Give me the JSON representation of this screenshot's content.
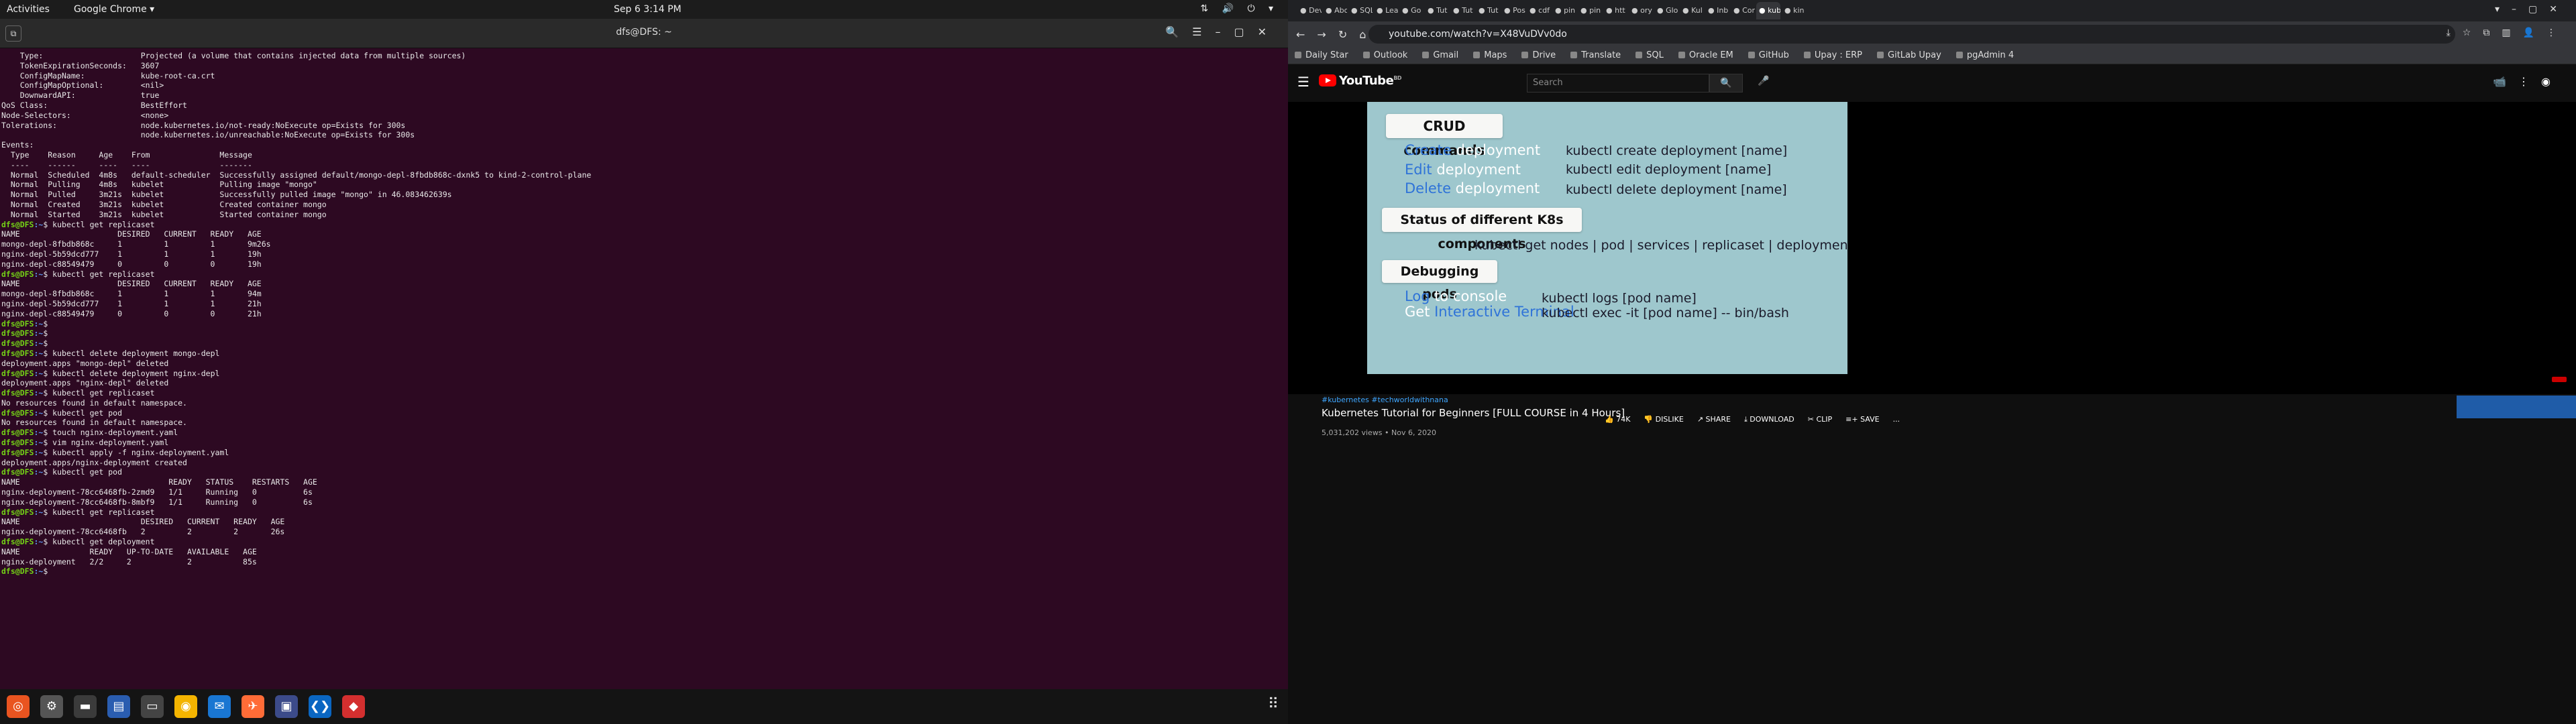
{
  "topbar": {
    "activities": "Activities",
    "app": "Google Chrome ▾",
    "clock": "Sep 6  3:14 PM",
    "tray": "⇅ 🔊 ⏻ ▾"
  },
  "terminal": {
    "title": "dfs@DFS: ~",
    "lines": [
      {
        "t": "    Type:                     Projected (a volume that contains injected data from multiple sources)"
      },
      {
        "t": "    TokenExpirationSeconds:   3607"
      },
      {
        "t": "    ConfigMapName:            kube-root-ca.crt"
      },
      {
        "t": "    ConfigMapOptional:        <nil>"
      },
      {
        "t": "    DownwardAPI:              true"
      },
      {
        "t": "QoS Class:                    BestEffort"
      },
      {
        "t": "Node-Selectors:               <none>"
      },
      {
        "t": "Tolerations:                  node.kubernetes.io/not-ready:NoExecute op=Exists for 300s"
      },
      {
        "t": "                              node.kubernetes.io/unreachable:NoExecute op=Exists for 300s"
      },
      {
        "t": "Events:"
      },
      {
        "t": "  Type    Reason     Age    From               Message"
      },
      {
        "t": "  ----    ------     ----   ----               -------"
      },
      {
        "t": "  Normal  Scheduled  4m8s   default-scheduler  Successfully assigned default/mongo-depl-8fbdb868c-dxnk5 to kind-2-control-plane"
      },
      {
        "t": "  Normal  Pulling    4m8s   kubelet            Pulling image \"mongo\""
      },
      {
        "t": "  Normal  Pulled     3m21s  kubelet            Successfully pulled image \"mongo\" in 46.083462639s"
      },
      {
        "t": "  Normal  Created    3m21s  kubelet            Created container mongo"
      },
      {
        "t": "  Normal  Started    3m21s  kubelet            Started container mongo"
      },
      {
        "p": "dfs@DFS",
        "d": ":~",
        "c": "$ kubectl get replicaset"
      },
      {
        "t": "NAME                     DESIRED   CURRENT   READY   AGE"
      },
      {
        "t": "mongo-depl-8fbdb868c     1         1         1       9m26s"
      },
      {
        "t": "nginx-depl-5b59dcd777    1         1         1       19h"
      },
      {
        "t": "nginx-depl-c88549479     0         0         0       19h"
      },
      {
        "p": "dfs@DFS",
        "d": ":~",
        "c": "$ kubectl get replicaset"
      },
      {
        "t": "NAME                     DESIRED   CURRENT   READY   AGE"
      },
      {
        "t": "mongo-depl-8fbdb868c     1         1         1       94m"
      },
      {
        "t": "nginx-depl-5b59dcd777    1         1         1       21h"
      },
      {
        "t": "nginx-depl-c88549479     0         0         0       21h"
      },
      {
        "p": "dfs@DFS",
        "d": ":~",
        "c": "$"
      },
      {
        "p": "dfs@DFS",
        "d": ":~",
        "c": "$"
      },
      {
        "p": "dfs@DFS",
        "d": ":~",
        "c": "$"
      },
      {
        "p": "dfs@DFS",
        "d": ":~",
        "c": "$ kubectl delete deployment mongo-depl"
      },
      {
        "t": "deployment.apps \"mongo-depl\" deleted"
      },
      {
        "p": "dfs@DFS",
        "d": ":~",
        "c": "$ kubectl delete deployment nginx-depl"
      },
      {
        "t": "deployment.apps \"nginx-depl\" deleted"
      },
      {
        "p": "dfs@DFS",
        "d": ":~",
        "c": "$ kubectl get replicaset"
      },
      {
        "t": "No resources found in default namespace."
      },
      {
        "p": "dfs@DFS",
        "d": ":~",
        "c": "$ kubectl get pod"
      },
      {
        "t": "No resources found in default namespace."
      },
      {
        "p": "dfs@DFS",
        "d": ":~",
        "c": "$ touch nginx-deployment.yaml"
      },
      {
        "p": "dfs@DFS",
        "d": ":~",
        "c": "$ vim nginx-deployment.yaml"
      },
      {
        "p": "dfs@DFS",
        "d": ":~",
        "c": "$ kubectl apply -f nginx-deployment.yaml"
      },
      {
        "t": "deployment.apps/nginx-deployment created"
      },
      {
        "p": "dfs@DFS",
        "d": ":~",
        "c": "$ kubectl get pod"
      },
      {
        "t": "NAME                                READY   STATUS    RESTARTS   AGE"
      },
      {
        "t": "nginx-deployment-78cc6468fb-2zmd9   1/1     Running   0          6s"
      },
      {
        "t": "nginx-deployment-78cc6468fb-8mbf9   1/1     Running   0          6s"
      },
      {
        "p": "dfs@DFS",
        "d": ":~",
        "c": "$ kubectl get replicaset"
      },
      {
        "t": "NAME                          DESIRED   CURRENT   READY   AGE"
      },
      {
        "t": "nginx-deployment-78cc6468fb   2         2         2       26s"
      },
      {
        "p": "dfs@DFS",
        "d": ":~",
        "c": "$ kubectl get deployment"
      },
      {
        "t": "NAME               READY   UP-TO-DATE   AVAILABLE   AGE"
      },
      {
        "t": "nginx-deployment   2/2     2            2           85s"
      },
      {
        "p": "dfs@DFS",
        "d": ":~",
        "c": "$ "
      }
    ]
  },
  "dock": [
    "Ubuntu",
    "Settings",
    "Files",
    "Docs",
    "Chrome",
    "Thunderbird",
    "Postman",
    "Screenshot",
    "VS Code",
    "AnyDesk"
  ],
  "browser": {
    "tabs": [
      "Dev",
      "Abo",
      "SQL",
      "Lea",
      "Go",
      "Tut",
      "Tut",
      "Tut",
      "Pos",
      "cdf",
      "pin",
      "pin",
      "htt",
      "ory",
      "Glo",
      "Kul",
      "Inb",
      "Cor",
      "kub",
      "kin"
    ],
    "url": "youtube.com/watch?v=X48VuDVv0do",
    "bookmarks": [
      "Daily Star",
      "Outlook",
      "Gmail",
      "Maps",
      "Drive",
      "Translate",
      "SQL",
      "Oracle EM",
      "GitHub",
      "Upay : ERP",
      "GitLab Upay",
      "pgAdmin 4"
    ]
  },
  "youtube": {
    "logo": "YouTube",
    "region": "BD",
    "search_placeholder": "Search",
    "slide": {
      "h1": "CRUD commands",
      "create_kw": "Create",
      "create_rest": " deployment",
      "create_cmd": "kubectl create deployment [name]",
      "edit_kw": "Edit",
      "edit_rest": " deployment",
      "edit_cmd": "kubectl edit deployment [name]",
      "delete_kw": "Delete",
      "delete_rest": " deployment",
      "delete_cmd": "kubectl delete deployment [name]",
      "h2": "Status of different K8s components",
      "status_cmd": "kubectl get nodes | pod | services | replicaset | deployment",
      "h3": "Debugging pods",
      "log_kw": "Log",
      "log_rest": " to console",
      "log_cmd": "kubectl logs [pod name]",
      "get_kw": "Get ",
      "get_rest": "Interactive Terminal",
      "get_cmd": "kubectl exec -it [pod name] -- bin/bash"
    },
    "tags": "#kubernetes #techworldwithnana",
    "title": "Kubernetes Tutorial for Beginners [FULL COURSE in 4 Hours]",
    "views": "5,031,202 views • Nov 6, 2020",
    "actions": {
      "like": "👍 74K",
      "dislike": "👎 DISLIKE",
      "share": "↗ SHARE",
      "download": "⤓ DOWNLOAD",
      "clip": "✂ CLIP",
      "save": "≡+ SAVE",
      "more": "..."
    }
  }
}
